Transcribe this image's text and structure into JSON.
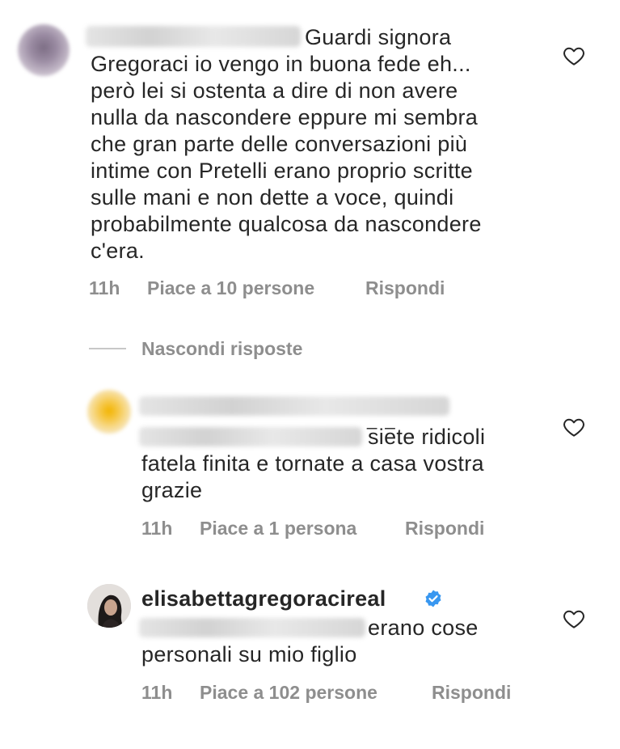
{
  "comments": [
    {
      "username_blurred": true,
      "text_lines": [
        "Guardi signora",
        "Gregoraci io vengo in buona fede eh...",
        "però lei si ostenta a dire di non avere",
        "nulla da nascondere eppure mi sembra",
        "che gran parte delle conversazioni più",
        "intime con Pretelli erano proprio scritte",
        "sulle mani e non dette a voce, quindi",
        "probabilmente qualcosa da nascondere",
        "c'era."
      ],
      "time": "11h",
      "likes": "Piace a 10 persone",
      "reply": "Rispondi"
    }
  ],
  "hide_replies": "Nascondi risposte",
  "replies": [
    {
      "username_blurred": true,
      "tag_suffix": "_ _",
      "text_lines": [
        "siete ridicoli",
        "fatela finita e tornate a casa vostra",
        "grazie"
      ],
      "time": "11h",
      "likes": "Piace a 1 persona",
      "reply": "Rispondi"
    },
    {
      "username": "elisabettagregoracireal",
      "verified": true,
      "text_lines": [
        "erano cose",
        "personali su mio figlio"
      ],
      "time": "11h",
      "likes": "Piace a 102 persone",
      "reply": "Rispondi"
    }
  ],
  "icons": {
    "like": "heart-outline-icon",
    "verified": "verified-badge-icon"
  },
  "colors": {
    "text": "#262626",
    "meta": "#8e8e8e",
    "verified": "#3897f0"
  }
}
